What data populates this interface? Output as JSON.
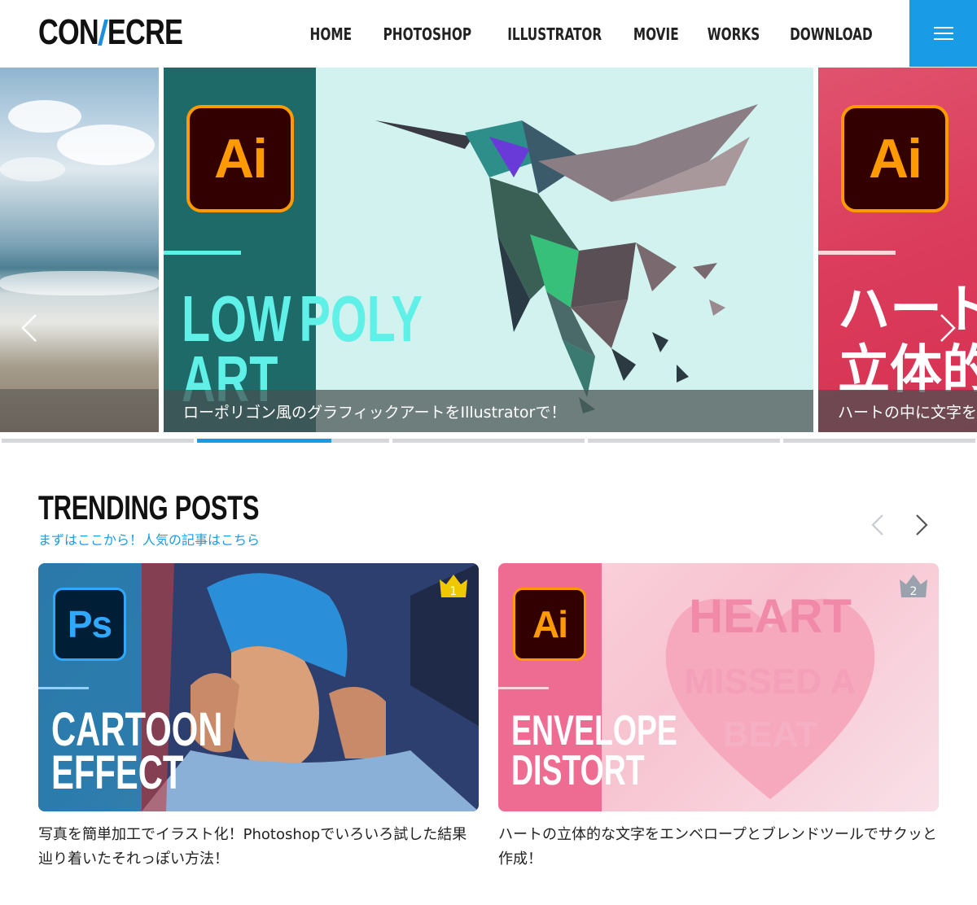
{
  "header": {
    "logo_left": "CON",
    "logo_right": "ECRE",
    "nav": [
      "HOME",
      "PHOTOSHOP",
      "ILLUSTRATOR",
      "MOVIE",
      "WORKS",
      "DOWNLOAD"
    ]
  },
  "slider": {
    "main": {
      "badge": "Ai",
      "title_line1_a": "LOW",
      "title_line1_b": "POLY",
      "title_line2": "ART",
      "caption": "ローポリゴン風のグラフィックアートをIllustratorで！"
    },
    "right": {
      "badge": "Ai",
      "title_line1": "ハート",
      "title_line2": "立体的",
      "caption": "ハートの中に文字を"
    },
    "active_index": 1,
    "active_progress": 0.7
  },
  "trending": {
    "title": "TRENDING POSTS",
    "subtitle": "まずはここから！人気の記事はこちら",
    "posts": [
      {
        "rank": "1",
        "badge": "Ps",
        "thumb_line1": "CARTOON",
        "thumb_line2": "EFFECT",
        "text": "写真を簡単加工でイラスト化！Photoshopでいろいろ試した結果辿り着いたそれっぽい方法！"
      },
      {
        "rank": "2",
        "badge": "Ai",
        "thumb_line1": "ENVELOPE",
        "thumb_line2": "DISTORT",
        "art_line1": "HEART",
        "art_line2": "MISSED A",
        "art_line3": "BEAT",
        "text": "ハートの立体的な文字をエンベロープとブレンドツールでサクッと作成！"
      }
    ]
  },
  "colors": {
    "accent": "#1a9be6",
    "ai_orange": "#ff9a00",
    "ps_blue": "#31a8ff",
    "rank1": "#f0c800",
    "rank2": "#9aa3ad"
  }
}
